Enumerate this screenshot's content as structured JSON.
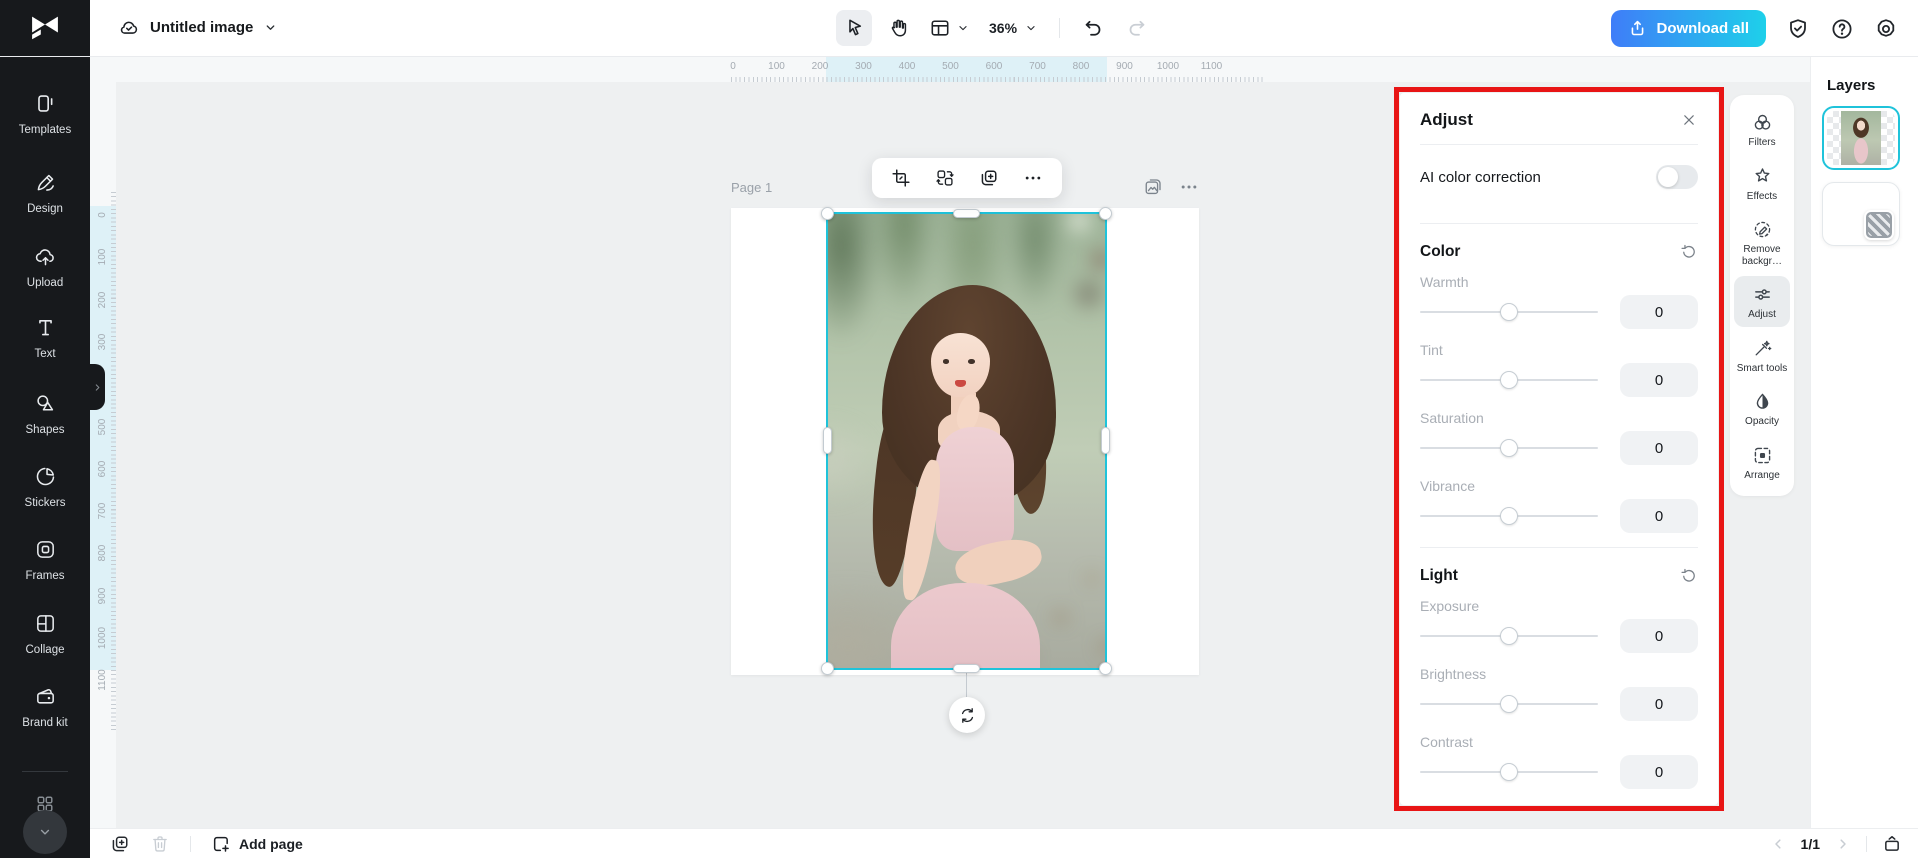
{
  "colors": {
    "accent": "#1fc3da",
    "annotation": "#e81515",
    "download_from": "#3f7df8",
    "download_to": "#1ed0ea",
    "sidebar_bg": "#17191c",
    "canvas_bg": "#eef0f1",
    "ruler_highlight": "#def1f7"
  },
  "topbar": {
    "document_title": "Untitled image",
    "zoom_level": "36%",
    "download_label": "Download all"
  },
  "sidebar": {
    "items": [
      {
        "icon": "templates-icon",
        "label": "Templates"
      },
      {
        "icon": "design-icon",
        "label": "Design"
      },
      {
        "icon": "upload-icon",
        "label": "Upload"
      },
      {
        "icon": "text-icon",
        "label": "Text"
      },
      {
        "icon": "shapes-icon",
        "label": "Shapes"
      },
      {
        "icon": "stickers-icon",
        "label": "Stickers"
      },
      {
        "icon": "frames-icon",
        "label": "Frames"
      },
      {
        "icon": "collage-icon",
        "label": "Collage"
      },
      {
        "icon": "brand-kit-icon",
        "label": "Brand kit"
      }
    ]
  },
  "canvas": {
    "page_label": "Page 1",
    "h_ruler_labels": [
      "0",
      "100",
      "200",
      "300",
      "400",
      "500",
      "600",
      "700",
      "800",
      "900",
      "1000",
      "1100"
    ],
    "v_ruler_labels": [
      "0",
      "100",
      "200",
      "300",
      "400",
      "500",
      "600",
      "700",
      "800",
      "900",
      "1000",
      "1100"
    ],
    "image_toolbar_icons": [
      "crop-icon",
      "replace-icon",
      "duplicate-icon",
      "more-icon"
    ]
  },
  "adjust_panel": {
    "title": "Adjust",
    "ai_label": "AI color correction",
    "ai_enabled": false,
    "sections": [
      {
        "title": "Color",
        "sliders": [
          {
            "label": "Warmth",
            "value": "0"
          },
          {
            "label": "Tint",
            "value": "0"
          },
          {
            "label": "Saturation",
            "value": "0"
          },
          {
            "label": "Vibrance",
            "value": "0"
          }
        ]
      },
      {
        "title": "Light",
        "sliders": [
          {
            "label": "Exposure",
            "value": "0"
          },
          {
            "label": "Brightness",
            "value": "0"
          },
          {
            "label": "Contrast",
            "value": "0"
          }
        ]
      }
    ]
  },
  "tool_rail": {
    "items": [
      {
        "icon": "filters-icon",
        "label": "Filters",
        "active": false
      },
      {
        "icon": "effects-icon",
        "label": "Effects",
        "active": false
      },
      {
        "icon": "remove-bg-icon",
        "label": "Remove backgr…",
        "active": false
      },
      {
        "icon": "adjust-icon",
        "label": "Adjust",
        "active": true
      },
      {
        "icon": "smart-tools-icon",
        "label": "Smart tools",
        "active": false
      },
      {
        "icon": "opacity-icon",
        "label": "Opacity",
        "active": false
      },
      {
        "icon": "arrange-icon",
        "label": "Arrange",
        "active": false
      }
    ]
  },
  "layers": {
    "title": "Layers",
    "items": [
      {
        "name": "photo",
        "selected": true
      },
      {
        "name": "background",
        "selected": false
      }
    ]
  },
  "bottombar": {
    "add_page_label": "Add page",
    "page_indicator": "1/1"
  }
}
